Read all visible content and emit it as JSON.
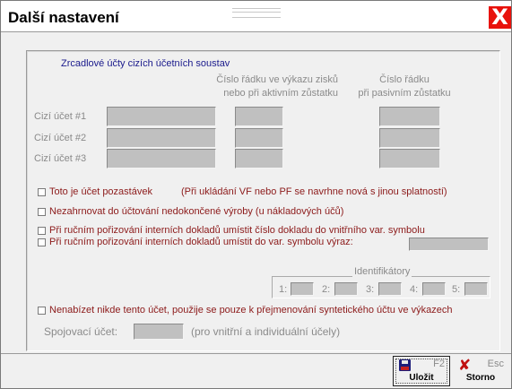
{
  "window": {
    "title": "Další nastavení",
    "close_glyph": "X"
  },
  "section": {
    "title": "Zrcadlové účty cizích účetních soustav",
    "col_profit_loss_line1": "Číslo řádku ve výkazu zisků",
    "col_profit_loss_line2": "nebo při aktivním zůstatku",
    "col_passive_line1": "Číslo řádku",
    "col_passive_line2": "při pasivním zůstatku",
    "rows": [
      {
        "label": "Cizí účet #1",
        "account": "",
        "line_profit": "",
        "line_passive": ""
      },
      {
        "label": "Cizí účet #2",
        "account": "",
        "line_profit": "",
        "line_passive": ""
      },
      {
        "label": "Cizí účet #3",
        "account": "",
        "line_profit": "",
        "line_passive": ""
      }
    ]
  },
  "options": {
    "holdings_account": {
      "label": "Toto je účet pozastávek",
      "note": "(Při ukládání VF nebo PF se navrhne nová s jinou splatností)",
      "checked": false
    },
    "exclude_wip": {
      "label": "Nezahrnovat do účtování nedokončené výroby (u nákladových účů)",
      "checked": false
    },
    "internal_doc_number": {
      "label": "Při ručním pořizování interních dokladů umístit číslo dokladu do vnitřního var. symbolu",
      "checked": false
    },
    "internal_doc_expression": {
      "label": "Při ručním pořizování interních dokladů umístit do var. symbolu výraz:",
      "checked": false,
      "value": ""
    },
    "rename_only": {
      "label": "Nenabízet nikde tento účet, použije se pouze k přejmenování syntetického účtu ve výkazech",
      "checked": false
    }
  },
  "identifiers": {
    "title": "Identifikátory",
    "items": [
      {
        "label": "1:",
        "value": ""
      },
      {
        "label": "2:",
        "value": ""
      },
      {
        "label": "3:",
        "value": ""
      },
      {
        "label": "4:",
        "value": ""
      },
      {
        "label": "5:",
        "value": ""
      }
    ]
  },
  "linking": {
    "label": "Spojovací účet:",
    "value": "",
    "note": "(pro vnitřní a individuální účely)"
  },
  "buttons": {
    "save": {
      "key": "F2",
      "label": "Uložit",
      "icon": "floppy-icon"
    },
    "cancel": {
      "key": "Esc",
      "label": "Storno",
      "icon": "cross-icon"
    }
  },
  "colors": {
    "accent_blue": "#1a1a8c",
    "option_red": "#8c1a1a",
    "close_red": "#e8120c",
    "disabled_gray": "#8a8a8a"
  }
}
